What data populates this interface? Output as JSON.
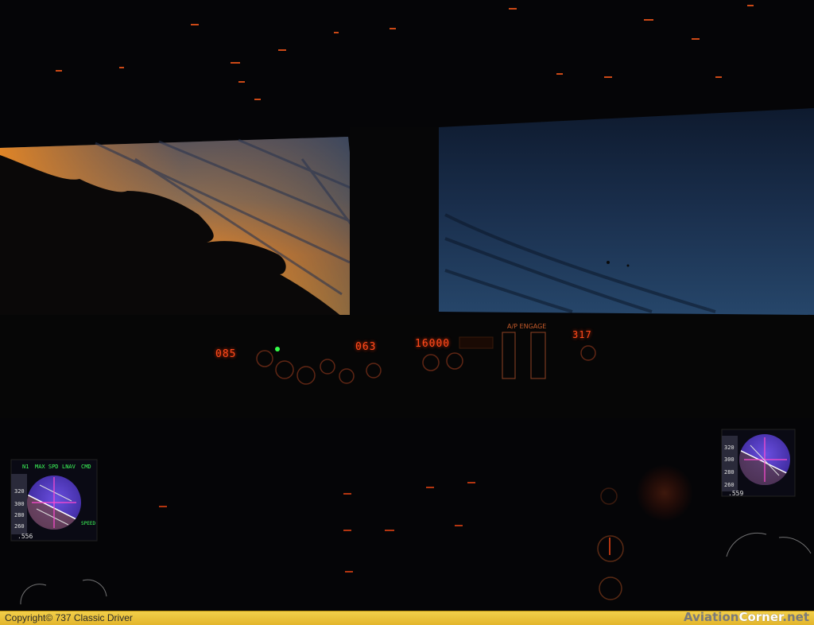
{
  "mcp": {
    "course_left": "085",
    "heading": "063",
    "altitude": "16000",
    "ap_engage_label": "A/P ENGAGE",
    "course_right": "317"
  },
  "pfd_left": {
    "mach": ".556",
    "speed_ticks": [
      "320",
      "300",
      "280",
      "260"
    ],
    "fma": [
      "N1",
      "MAX SPD",
      "LNAV",
      "CMD"
    ],
    "speed_label": "SPEED"
  },
  "pfd_right": {
    "mach": ".559",
    "speed_ticks": [
      "320",
      "300",
      "280",
      "260"
    ]
  },
  "footer": {
    "copyright": "Copyright©  737 Classic Driver",
    "brand_part1": "Aviation",
    "brand_part2": "Corner",
    "brand_part3": ".net"
  },
  "colors": {
    "sunset_orange": "#f7941e",
    "night_blue": "#1b3a5c",
    "display_red": "#ff4a1c",
    "banner_yellow": "#f0c83c"
  }
}
